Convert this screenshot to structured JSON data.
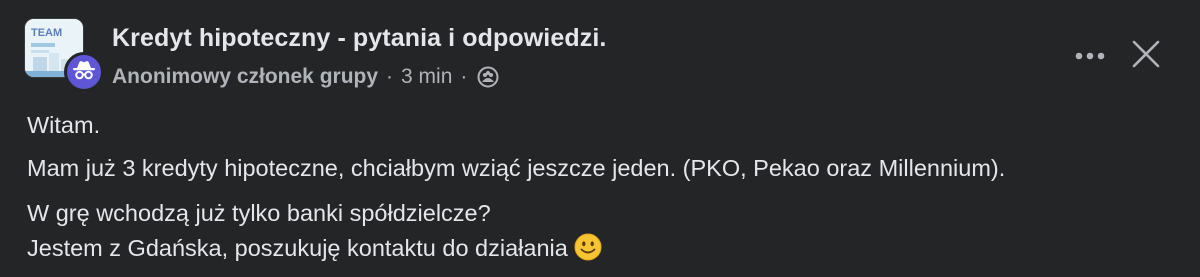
{
  "post": {
    "group_name": "Kredyt hipoteczny - pytania i odpowiedzi.",
    "group_avatar_text": "TEAM",
    "author": "Anonimowy członek grupy",
    "separator": "·",
    "time": "3 min",
    "privacy_icon": "group-members-icon",
    "badge_icon": "anonymous-incognito-icon",
    "paragraphs": [
      "Witam.",
      "Mam już 3 kredyty hipoteczne, chciałbym wziąć jeszcze jeden. (PKO, Pekao oraz Millennium).",
      "W grę wchodzą już tylko banki spółdzielcze?",
      "Jestem z Gdańska, poszukuję kontaktu do działania"
    ],
    "emoji": "slightly-smiling-face-emoji"
  },
  "actions": {
    "more_icon": "more-horizontal-icon",
    "close_icon": "close-icon"
  },
  "colors": {
    "background": "#242526",
    "primary_text": "#e4e6eb",
    "secondary_text": "#b0b3b8",
    "badge": "#5e56d6"
  }
}
